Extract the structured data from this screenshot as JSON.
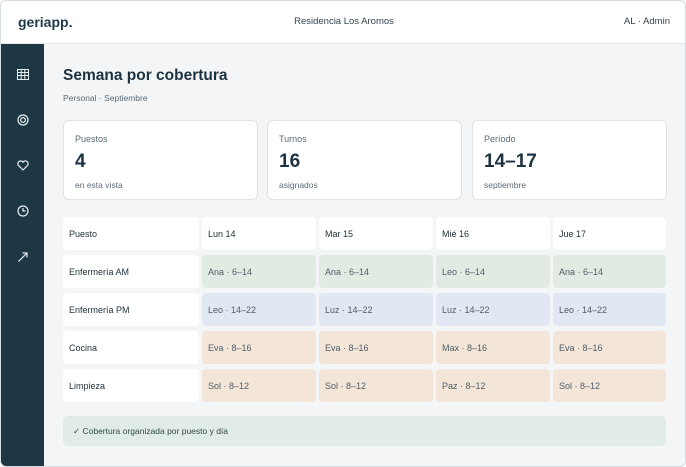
{
  "topbar": {
    "brand": "geriapp.",
    "residence": "Residencia Los Aromos",
    "user": "AL · Admin"
  },
  "sidebar": {
    "items": [
      {
        "icon": "calendar-grid-icon"
      },
      {
        "icon": "target-icon"
      },
      {
        "icon": "heart-icon"
      },
      {
        "icon": "clock-icon"
      },
      {
        "icon": "trend-arrow-icon"
      }
    ]
  },
  "page": {
    "title": "Semana por cobertura",
    "subtitle": "Personal · Septiembre"
  },
  "stats": [
    {
      "label": "Puestos",
      "value": "4",
      "note": "en esta vista"
    },
    {
      "label": "Turnos",
      "value": "16",
      "note": "asignados"
    },
    {
      "label": "Período",
      "value": "14–17",
      "note": "septiembre"
    }
  ],
  "table": {
    "corner": "Puesto",
    "days": [
      "Lun 14",
      "Mar 15",
      "Mié 16",
      "Jue 17"
    ],
    "rows": [
      {
        "post": "Enfermería AM",
        "color": "#e1ebe3",
        "cells": [
          "Ana · 6–14",
          "Ana · 6–14",
          "Leo · 6–14",
          "Ana · 6–14"
        ]
      },
      {
        "post": "Enfermería PM",
        "color": "#e2e8f3",
        "cells": [
          "Leo · 14–22",
          "Luz · 14–22",
          "Luz · 14–22",
          "Leo · 14–22"
        ]
      },
      {
        "post": "Cocina",
        "color": "#f3e5d8",
        "cells": [
          "Eva · 8–16",
          "Eva · 8–16",
          "Max · 8–16",
          "Eva · 8–16"
        ]
      },
      {
        "post": "Limpieza",
        "color": "#f3e5d8",
        "cells": [
          "Sol · 8–12",
          "Sol · 8–12",
          "Paz · 8–12",
          "Sol · 8–12"
        ]
      }
    ]
  },
  "footer": {
    "text": "✓ Cobertura organizada por puesto y día"
  }
}
